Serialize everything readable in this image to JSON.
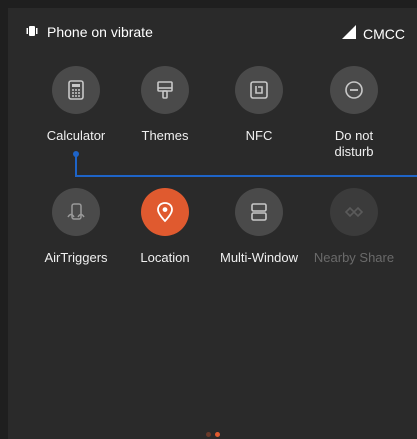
{
  "status_bar": {
    "mode_text": "Phone on vibrate",
    "carrier": "CMCC",
    "vibrate_icon": "vibrate-icon",
    "signal_icon": "cell-signal-icon"
  },
  "tiles": [
    {
      "id": "calculator",
      "label": "Calculator",
      "icon": "calculator-icon"
    },
    {
      "id": "themes",
      "label": "Themes",
      "icon": "themes-brush-icon"
    },
    {
      "id": "nfc",
      "label": "NFC",
      "icon": "nfc-icon"
    },
    {
      "id": "do-not-disturb",
      "label": "Do not\ndisturb",
      "icon": "do-not-disturb-icon"
    },
    {
      "id": "airtriggers",
      "label": "AirTriggers",
      "icon": "airtriggers-icon"
    },
    {
      "id": "location",
      "label": "Location",
      "icon": "location-pin-icon",
      "state": "on"
    },
    {
      "id": "multi-window",
      "label": "Multi-Window",
      "icon": "multi-window-icon"
    },
    {
      "id": "nearby-share",
      "label": "Nearby Share",
      "icon": "nearby-share-icon",
      "state": "disabled"
    }
  ],
  "colors": {
    "active": "#e05a2f",
    "connector": "#1e64c8"
  },
  "page_indicator": {
    "pages": 2,
    "current": 2
  }
}
